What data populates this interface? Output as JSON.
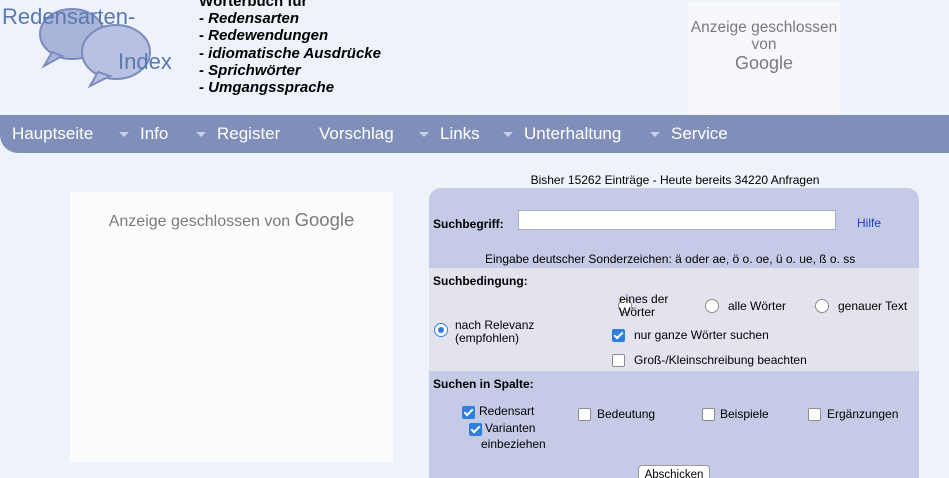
{
  "logo": {
    "line1": "Redensarten-",
    "line2": "Index"
  },
  "dictionary": {
    "title": "Wörterbuch für",
    "items": [
      "- Redensarten",
      "- Redewendungen",
      "- idiomatische Ausdrücke",
      "- Sprichwörter",
      "- Umgangssprache"
    ]
  },
  "ad_top": {
    "text": "Anzeige geschlossen von",
    "brand": "Google"
  },
  "nav": {
    "items": [
      "Hauptseite",
      "Info",
      "Register",
      "Vorschlag",
      "Links",
      "Unterhaltung",
      "Service"
    ]
  },
  "ad_left": {
    "text": "Anzeige geschlossen von",
    "brand": "Google"
  },
  "stats": "Bisher 15262 Einträge - Heute bereits 34220 Anfragen",
  "search": {
    "label": "Suchbegriff:",
    "value": "",
    "help": "Hilfe",
    "special_chars": "Eingabe deutscher Sonderzeichen: ä oder ae, ö o. oe, ü o. ue, ß o. ss"
  },
  "condition": {
    "label": "Suchbedingung:",
    "relevance": "nach Relevanz (empfohlen)",
    "relevance_line1": "nach Relevanz",
    "relevance_line2": "(empfohlen)",
    "one_of_line1": "eines der",
    "one_of_line2": "Wörter",
    "all_words": "alle Wörter",
    "exact_text": "genauer Text",
    "whole_words": "nur ganze Wörter suchen",
    "case_sensitive": "Groß-/Kleinschreibung beachten",
    "selected": "nach Relevanz",
    "whole_words_checked": true,
    "case_sensitive_checked": false
  },
  "columns": {
    "label": "Suchen in Spalte:",
    "redensart": "Redensart",
    "variants_line1": "Varianten",
    "variants_line2": "einbeziehen",
    "bedeutung": "Bedeutung",
    "beispiele": "Beispiele",
    "ergaenzungen": "Ergänzungen",
    "checked": [
      "Redensart",
      "Varianten einbeziehen"
    ]
  },
  "submit": "Abschicken",
  "colors": {
    "page_bg": "#eef3fb",
    "nav_bg": "#7f8fba",
    "panel_bg": "#c5cbe6",
    "condition_bg": "#e3e3ee",
    "accent": "#2f7fe0",
    "link": "#1a3fc6",
    "logo": "#5a79b0"
  }
}
